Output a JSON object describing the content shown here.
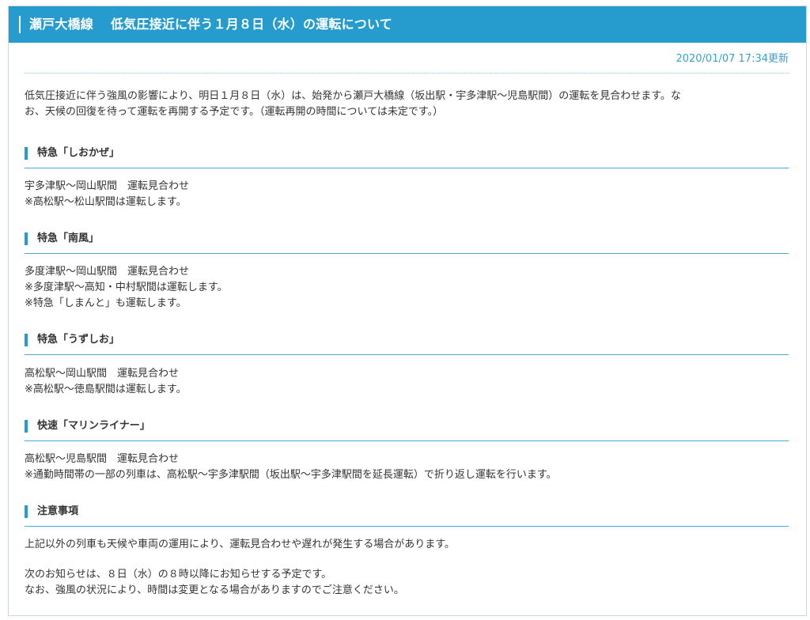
{
  "header": {
    "title": "瀬戸大橋線　 低気圧接近に伴う１月８日（水）の運転について"
  },
  "updated": "2020/01/07 17:34更新",
  "intro": [
    "低気圧接近に伴う強風の影響により、明日１月８日（水）は、始発から瀬戸大橋線（坂出駅・宇多津駅～児島駅間）の運転を見合わせます。な",
    "お、天候の回復を待って運転を再開する予定です。（運転再開の時間については未定です。）"
  ],
  "sections": [
    {
      "title": "特急「しおかぜ」",
      "lines": [
        "宇多津駅～岡山駅間　運転見合わせ",
        "※高松駅～松山駅間は運転します。"
      ]
    },
    {
      "title": "特急「南風」",
      "lines": [
        "多度津駅～岡山駅間　運転見合わせ",
        "※多度津駅～高知・中村駅間は運転します。",
        "※特急「しまんと」も運転します。"
      ]
    },
    {
      "title": "特急「うずしお」",
      "lines": [
        "高松駅～岡山駅間　運転見合わせ",
        "※高松駅～徳島駅間は運転します。"
      ]
    },
    {
      "title": "快速「マリンライナー」",
      "lines": [
        "高松駅～児島駅間　運転見合わせ",
        "※通勤時間帯の一部の列車は、高松駅～宇多津駅間（坂出駅～宇多津駅間を延長運転）で折り返し運転を行います。"
      ]
    },
    {
      "title": "注意事項",
      "lines": [
        "上記以外の列車も天候や車両の運用により、運転見合わせや遅れが発生する場合があります。"
      ]
    }
  ],
  "closing": [
    "次のお知らせは、８日（水）の８時以降にお知らせする予定です。",
    "なお、強風の状況により、時間は変更となる場合がありますのでご注意ください。"
  ]
}
